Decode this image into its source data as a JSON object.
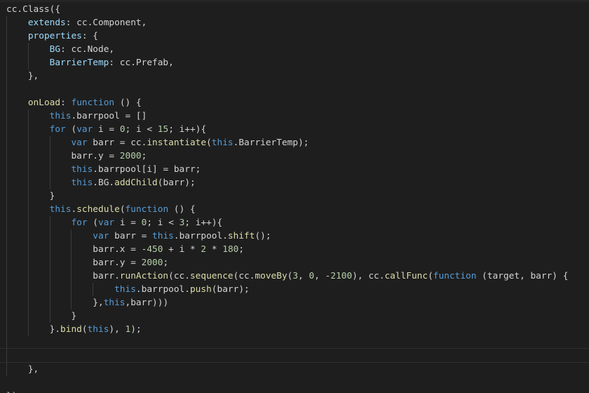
{
  "editor": {
    "language": "JavaScript",
    "colors": {
      "background": "#1e1e1e",
      "text": "#d4d4d4",
      "keyword": "#569cd6",
      "property": "#9cdcfe",
      "function": "#dcdcaa",
      "number": "#b5cea8",
      "indent_guide": "#3b3b3b"
    },
    "lines": [
      [
        {
          "t": "cc.Class({",
          "c": "punc"
        }
      ],
      [
        {
          "t": "    ",
          "c": "punc"
        },
        {
          "t": "extends",
          "c": "prop"
        },
        {
          "t": ": cc.Component,",
          "c": "punc"
        }
      ],
      [
        {
          "t": "    ",
          "c": "punc"
        },
        {
          "t": "properties",
          "c": "prop"
        },
        {
          "t": ": {",
          "c": "punc"
        }
      ],
      [
        {
          "t": "        ",
          "c": "punc"
        },
        {
          "t": "BG",
          "c": "prop"
        },
        {
          "t": ": cc.Node,",
          "c": "punc"
        }
      ],
      [
        {
          "t": "        ",
          "c": "punc"
        },
        {
          "t": "BarrierTemp",
          "c": "prop"
        },
        {
          "t": ": cc.Prefab,",
          "c": "punc"
        }
      ],
      [
        {
          "t": "    },",
          "c": "punc"
        }
      ],
      [
        {
          "t": "",
          "c": "punc"
        }
      ],
      [
        {
          "t": "    ",
          "c": "punc"
        },
        {
          "t": "onLoad",
          "c": "fn"
        },
        {
          "t": ": ",
          "c": "punc"
        },
        {
          "t": "function",
          "c": "kw"
        },
        {
          "t": " () {",
          "c": "punc"
        }
      ],
      [
        {
          "t": "        ",
          "c": "punc"
        },
        {
          "t": "this",
          "c": "kw"
        },
        {
          "t": ".barrpool = []",
          "c": "punc"
        }
      ],
      [
        {
          "t": "        ",
          "c": "punc"
        },
        {
          "t": "for",
          "c": "kw"
        },
        {
          "t": " (",
          "c": "punc"
        },
        {
          "t": "var",
          "c": "kw"
        },
        {
          "t": " i = ",
          "c": "punc"
        },
        {
          "t": "0",
          "c": "num"
        },
        {
          "t": "; i < ",
          "c": "punc"
        },
        {
          "t": "15",
          "c": "num"
        },
        {
          "t": "; i++){",
          "c": "punc"
        }
      ],
      [
        {
          "t": "            ",
          "c": "punc"
        },
        {
          "t": "var",
          "c": "kw"
        },
        {
          "t": " barr = cc.",
          "c": "punc"
        },
        {
          "t": "instantiate",
          "c": "fn"
        },
        {
          "t": "(",
          "c": "punc"
        },
        {
          "t": "this",
          "c": "kw"
        },
        {
          "t": ".BarrierTemp);",
          "c": "punc"
        }
      ],
      [
        {
          "t": "            barr.y = ",
          "c": "punc"
        },
        {
          "t": "2000",
          "c": "num"
        },
        {
          "t": ";",
          "c": "punc"
        }
      ],
      [
        {
          "t": "            ",
          "c": "punc"
        },
        {
          "t": "this",
          "c": "kw"
        },
        {
          "t": ".barrpool[i] = barr;",
          "c": "punc"
        }
      ],
      [
        {
          "t": "            ",
          "c": "punc"
        },
        {
          "t": "this",
          "c": "kw"
        },
        {
          "t": ".BG.",
          "c": "punc"
        },
        {
          "t": "addChild",
          "c": "fn"
        },
        {
          "t": "(barr);",
          "c": "punc"
        }
      ],
      [
        {
          "t": "        }",
          "c": "punc"
        }
      ],
      [
        {
          "t": "        ",
          "c": "punc"
        },
        {
          "t": "this",
          "c": "kw"
        },
        {
          "t": ".",
          "c": "punc"
        },
        {
          "t": "schedule",
          "c": "fn"
        },
        {
          "t": "(",
          "c": "punc"
        },
        {
          "t": "function",
          "c": "kw"
        },
        {
          "t": " () {",
          "c": "punc"
        }
      ],
      [
        {
          "t": "            ",
          "c": "punc"
        },
        {
          "t": "for",
          "c": "kw"
        },
        {
          "t": " (",
          "c": "punc"
        },
        {
          "t": "var",
          "c": "kw"
        },
        {
          "t": " i = ",
          "c": "punc"
        },
        {
          "t": "0",
          "c": "num"
        },
        {
          "t": "; i < ",
          "c": "punc"
        },
        {
          "t": "3",
          "c": "num"
        },
        {
          "t": "; i++){",
          "c": "punc"
        }
      ],
      [
        {
          "t": "                ",
          "c": "punc"
        },
        {
          "t": "var",
          "c": "kw"
        },
        {
          "t": " barr = ",
          "c": "punc"
        },
        {
          "t": "this",
          "c": "kw"
        },
        {
          "t": ".barrpool.",
          "c": "punc"
        },
        {
          "t": "shift",
          "c": "fn"
        },
        {
          "t": "();",
          "c": "punc"
        }
      ],
      [
        {
          "t": "                barr.x = -",
          "c": "punc"
        },
        {
          "t": "450",
          "c": "num"
        },
        {
          "t": " + i * ",
          "c": "punc"
        },
        {
          "t": "2",
          "c": "num"
        },
        {
          "t": " * ",
          "c": "punc"
        },
        {
          "t": "180",
          "c": "num"
        },
        {
          "t": ";",
          "c": "punc"
        }
      ],
      [
        {
          "t": "                barr.y = ",
          "c": "punc"
        },
        {
          "t": "2000",
          "c": "num"
        },
        {
          "t": ";",
          "c": "punc"
        }
      ],
      [
        {
          "t": "                barr.",
          "c": "punc"
        },
        {
          "t": "runAction",
          "c": "fn"
        },
        {
          "t": "(cc.",
          "c": "punc"
        },
        {
          "t": "sequence",
          "c": "fn"
        },
        {
          "t": "(cc.",
          "c": "punc"
        },
        {
          "t": "moveBy",
          "c": "fn"
        },
        {
          "t": "(",
          "c": "punc"
        },
        {
          "t": "3",
          "c": "num"
        },
        {
          "t": ", ",
          "c": "punc"
        },
        {
          "t": "0",
          "c": "num"
        },
        {
          "t": ", -",
          "c": "punc"
        },
        {
          "t": "2100",
          "c": "num"
        },
        {
          "t": "), cc.",
          "c": "punc"
        },
        {
          "t": "callFunc",
          "c": "fn"
        },
        {
          "t": "(",
          "c": "punc"
        },
        {
          "t": "function",
          "c": "kw"
        },
        {
          "t": " (target, barr) {",
          "c": "punc"
        }
      ],
      [
        {
          "t": "                    ",
          "c": "punc"
        },
        {
          "t": "this",
          "c": "kw"
        },
        {
          "t": ".barrpool.",
          "c": "punc"
        },
        {
          "t": "push",
          "c": "fn"
        },
        {
          "t": "(barr);",
          "c": "punc"
        }
      ],
      [
        {
          "t": "                },",
          "c": "punc"
        },
        {
          "t": "this",
          "c": "kw"
        },
        {
          "t": ",barr)))",
          "c": "punc"
        }
      ],
      [
        {
          "t": "            }",
          "c": "punc"
        }
      ],
      [
        {
          "t": "        }.",
          "c": "punc"
        },
        {
          "t": "bind",
          "c": "fn"
        },
        {
          "t": "(",
          "c": "punc"
        },
        {
          "t": "this",
          "c": "kw"
        },
        {
          "t": "), ",
          "c": "punc"
        },
        {
          "t": "1",
          "c": "num"
        },
        {
          "t": ");",
          "c": "punc"
        }
      ],
      [
        {
          "t": "",
          "c": "punc"
        }
      ],
      [
        {
          "t": "",
          "c": "punc"
        }
      ],
      [
        {
          "t": "    },",
          "c": "punc"
        }
      ],
      [
        {
          "t": "",
          "c": "punc"
        }
      ],
      [
        {
          "t": "});",
          "c": "punc"
        }
      ]
    ]
  }
}
